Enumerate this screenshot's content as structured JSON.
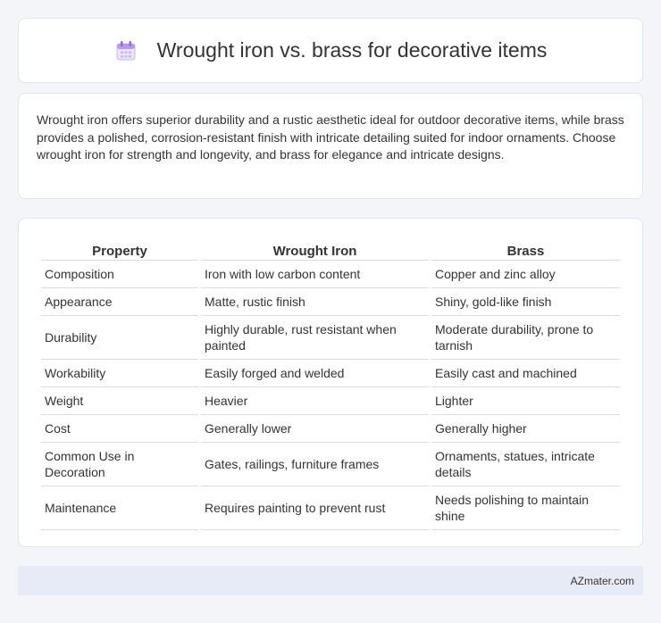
{
  "header": {
    "title": "Wrought iron vs. brass for decorative items",
    "icon": "calendar-icon"
  },
  "summary": {
    "text": "Wrought iron offers superior durability and a rustic aesthetic ideal for outdoor decorative items, while brass provides a polished, corrosion-resistant finish with intricate detailing suited for indoor ornaments. Choose wrought iron for strength and longevity, and brass for elegance and intricate designs."
  },
  "table": {
    "headers": [
      "Property",
      "Wrought Iron",
      "Brass"
    ],
    "rows": [
      [
        "Composition",
        "Iron with low carbon content",
        "Copper and zinc alloy"
      ],
      [
        "Appearance",
        "Matte, rustic finish",
        "Shiny, gold-like finish"
      ],
      [
        "Durability",
        "Highly durable, rust resistant when painted",
        "Moderate durability, prone to tarnish"
      ],
      [
        "Workability",
        "Easily forged and welded",
        "Easily cast and machined"
      ],
      [
        "Weight",
        "Heavier",
        "Lighter"
      ],
      [
        "Cost",
        "Generally lower",
        "Generally higher"
      ],
      [
        "Common Use in Decoration",
        "Gates, railings, furniture frames",
        "Ornaments, statues, intricate details"
      ],
      [
        "Maintenance",
        "Requires painting to prevent rust",
        "Needs polishing to maintain shine"
      ]
    ]
  },
  "footer": {
    "brand": "AZmater.com"
  }
}
